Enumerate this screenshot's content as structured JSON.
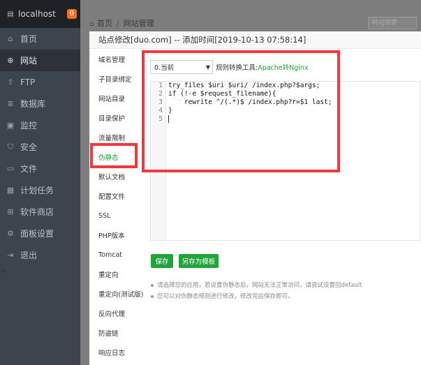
{
  "sidebar": {
    "host": "localhost",
    "badge": "0",
    "items": [
      {
        "label": "首页",
        "icon": "home-icon",
        "glyph": "⌂",
        "active": false
      },
      {
        "label": "网站",
        "icon": "globe-icon",
        "glyph": "⊕",
        "active": true
      },
      {
        "label": "FTP",
        "icon": "ftp-icon",
        "glyph": "⇪",
        "active": false
      },
      {
        "label": "数据库",
        "icon": "database-icon",
        "glyph": "≣",
        "active": false
      },
      {
        "label": "监控",
        "icon": "monitor-icon",
        "glyph": "▣",
        "active": false
      },
      {
        "label": "安全",
        "icon": "shield-icon",
        "glyph": "⛉",
        "active": false
      },
      {
        "label": "文件",
        "icon": "folder-icon",
        "glyph": "▭",
        "active": false
      },
      {
        "label": "计划任务",
        "icon": "calendar-icon",
        "glyph": "▦",
        "active": false
      },
      {
        "label": "软件商店",
        "icon": "grid-icon",
        "glyph": "⊞",
        "active": false
      },
      {
        "label": "面板设置",
        "icon": "gear-icon",
        "glyph": "⚙",
        "active": false
      },
      {
        "label": "退出",
        "icon": "logout-icon",
        "glyph": "⇥",
        "active": false
      }
    ],
    "add_label": "+"
  },
  "breadcrumb": {
    "home": "首页",
    "current": "网站管理"
  },
  "background_search": {
    "placeholder": "网站搜索"
  },
  "modal": {
    "title": "站点修改[duo.com] -- 添加时间[2019-10-13 07:58:14]",
    "tabs": [
      "域名管理",
      "子目录绑定",
      "网站目录",
      "目录保护",
      "流量限制",
      "伪静态",
      "默认文档",
      "配置文件",
      "SSL",
      "PHP版本",
      "Tomcat",
      "重定向",
      "重定向(测试版)",
      "反向代理",
      "防盗链",
      "响应日志"
    ],
    "active_tab": "伪静态",
    "select_value": "0.当前",
    "converter_label": "规则转换工具:",
    "converter_link": "Apache转Nginx",
    "code_lines": [
      "try_files $uri $uri/ /index.php?$args;",
      "if (!-e $request_filename){",
      "    rewrite ^/(.*)$ /index.php?r=$1 last;",
      "}",
      ""
    ],
    "save_label": "保存",
    "template_label": "另存为模板",
    "tips": [
      "请选择您的应用，若设置伪静态后，网站无法正常访问，请尝试设置回default",
      "您可以对伪静态规则进行修改，修改完后保存即可。"
    ]
  },
  "colors": {
    "accent": "#20a53a",
    "highlight": "#f4363d",
    "sidebar": "#3c444d"
  }
}
